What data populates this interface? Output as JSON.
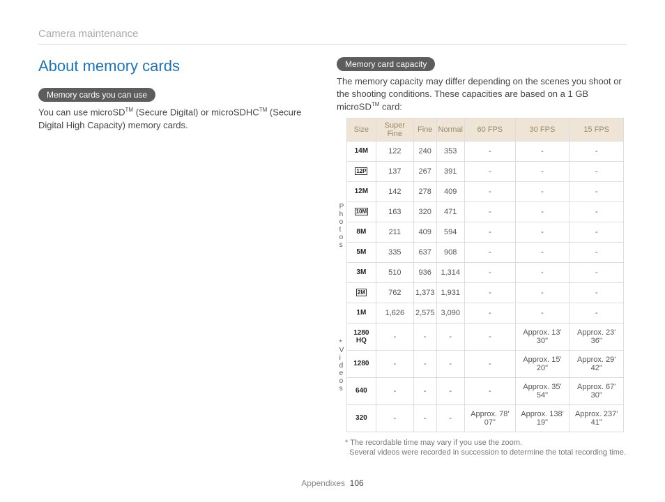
{
  "breadcrumb": "Camera maintenance",
  "title": "About memory cards",
  "left": {
    "pill": "Memory cards you can use",
    "text_1": "You can use microSD",
    "text_tm1": "TM",
    "text_2": " (Secure Digital) or microSDHC",
    "text_tm2": "TM",
    "text_3": " (Secure Digital High Capacity) memory cards."
  },
  "right": {
    "pill": "Memory card capacity",
    "intro": "The memory capacity may differ depending on the scenes you shoot or the shooting conditions. These capacities are based on a 1 GB microSD",
    "intro_tm": "TM",
    "intro_end": " card:",
    "headers": [
      "Size",
      "Super Fine",
      "Fine",
      "Normal",
      "60 FPS",
      "30 FPS",
      "15 FPS"
    ],
    "side_photos": "Photos",
    "side_videos": "* Videos",
    "photo_rows": [
      {
        "size": "14M",
        "sf": "122",
        "f": "240",
        "n": "353",
        "v1": "-",
        "v2": "-",
        "v3": "-"
      },
      {
        "size": "12P",
        "sf": "137",
        "f": "267",
        "n": "391",
        "v1": "-",
        "v2": "-",
        "v3": "-",
        "boxed": true
      },
      {
        "size": "12M",
        "sf": "142",
        "f": "278",
        "n": "409",
        "v1": "-",
        "v2": "-",
        "v3": "-"
      },
      {
        "size": "10M",
        "sf": "163",
        "f": "320",
        "n": "471",
        "v1": "-",
        "v2": "-",
        "v3": "-",
        "boxed": true
      },
      {
        "size": "8M",
        "sf": "211",
        "f": "409",
        "n": "594",
        "v1": "-",
        "v2": "-",
        "v3": "-"
      },
      {
        "size": "5M",
        "sf": "335",
        "f": "637",
        "n": "908",
        "v1": "-",
        "v2": "-",
        "v3": "-"
      },
      {
        "size": "3M",
        "sf": "510",
        "f": "936",
        "n": "1,314",
        "v1": "-",
        "v2": "-",
        "v3": "-"
      },
      {
        "size": "2M",
        "sf": "762",
        "f": "1,373",
        "n": "1,931",
        "v1": "-",
        "v2": "-",
        "v3": "-",
        "boxed": true
      },
      {
        "size": "1M",
        "sf": "1,626",
        "f": "2,575",
        "n": "3,090",
        "v1": "-",
        "v2": "-",
        "v3": "-"
      }
    ],
    "video_rows": [
      {
        "size": "1280 HQ",
        "sf": "-",
        "f": "-",
        "n": "-",
        "v1": "-",
        "v2": "Approx. 13' 30\"",
        "v3": "Approx. 23' 36\""
      },
      {
        "size": "1280",
        "sf": "-",
        "f": "-",
        "n": "-",
        "v1": "-",
        "v2": "Approx. 15' 20\"",
        "v3": "Approx. 29' 42\""
      },
      {
        "size": "640",
        "sf": "-",
        "f": "-",
        "n": "-",
        "v1": "-",
        "v2": "Approx. 35' 54\"",
        "v3": "Approx. 67' 30\""
      },
      {
        "size": "320",
        "sf": "-",
        "f": "-",
        "n": "-",
        "v1": "Approx. 78' 07\"",
        "v2": "Approx. 138' 19\"",
        "v3": "Approx. 237' 41\""
      }
    ],
    "footnote_1": "* The recordable time may vary if you use the zoom.",
    "footnote_2": "Several videos were recorded in succession to determine the total recording time."
  },
  "footer": {
    "section": "Appendixes",
    "page": "106"
  }
}
